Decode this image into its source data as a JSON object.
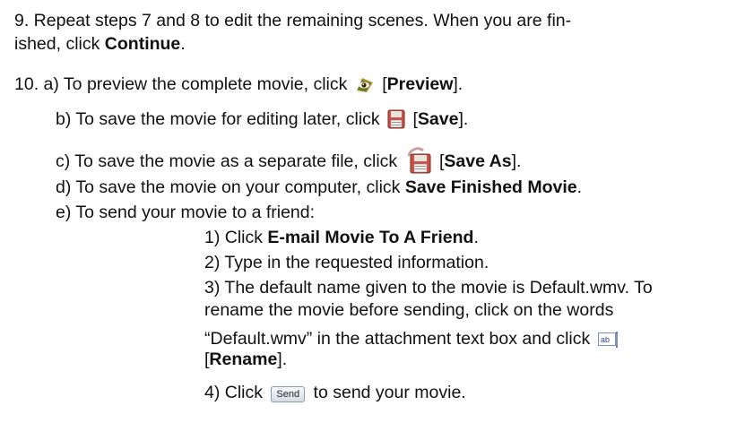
{
  "step9": {
    "line1": "9.  Repeat steps 7 and 8 to edit the remaining scenes.  When you are fin-",
    "line2_pre": "ished, click ",
    "line2_bold": "Continue",
    "line2_post": "."
  },
  "step10": {
    "a": {
      "pre": "10.  a)  To preview the complete movie, click ",
      "bracket_open": " [",
      "bold": "Preview",
      "post": "].",
      "icon": "preview-eye-icon"
    },
    "b": {
      "pre": "b)  To save the movie for editing later, click ",
      "bracket_open": " [",
      "bold": "Save",
      "post": "].",
      "icon": "save-disk-icon"
    },
    "c": {
      "pre": "c)  To save the movie as a separate file, click ",
      "bracket_open": " [",
      "bold": "Save As",
      "post": "].",
      "icon": "save-as-disk-icon"
    },
    "d": {
      "pre": "d)  To save the movie on your computer, click ",
      "bold": "Save Finished Movie",
      "post": "."
    },
    "e": {
      "text": "e)  To send your movie to a friend:",
      "sub1": {
        "pre": "1)  Click ",
        "bold": "E-mail Movie To A Friend",
        "post": "."
      },
      "sub2": "2)  Type in the requested information.",
      "sub3_line1": "3)  The default name given to the movie is Default.wmv.  To",
      "sub3_line2": "rename the movie before sending, click on the words",
      "sub3_line3_pre": "“Default.wmv” in the attachment text box and click ",
      "sub3_icon": "rename-textbox-icon",
      "sub3_line4_open": "[",
      "sub3_line4_bold": "Rename",
      "sub3_line4_post": "].",
      "sub4_pre": "4)  Click ",
      "sub4_button": "Send",
      "sub4_post": " to send your movie."
    }
  }
}
